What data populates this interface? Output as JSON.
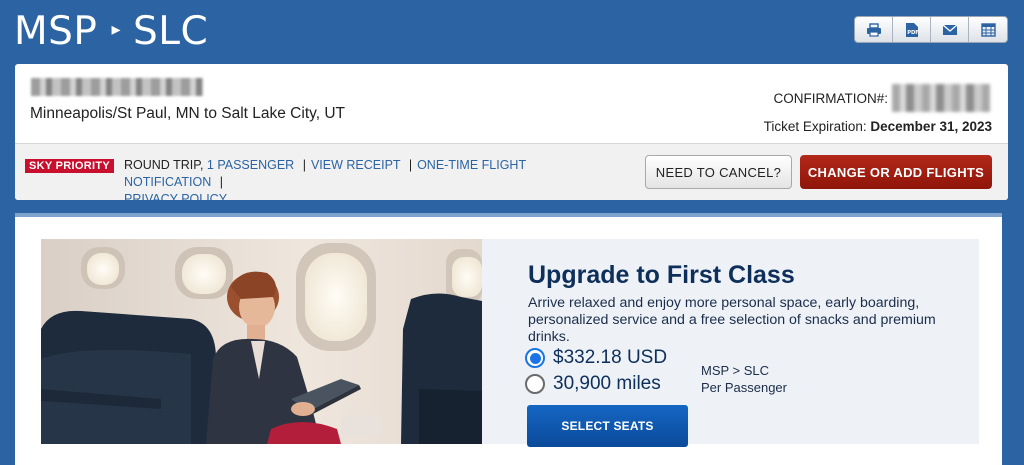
{
  "header": {
    "origin": "MSP",
    "destination": "SLC",
    "arrow": "▸",
    "tools": [
      {
        "name": "print-icon",
        "label": "🖶"
      },
      {
        "name": "pdf-icon",
        "label": "PDF"
      },
      {
        "name": "email-icon",
        "label": "✉"
      },
      {
        "name": "calendar-icon",
        "label": "▦"
      }
    ]
  },
  "trip": {
    "city_pair": "Minneapolis/St Paul, MN to Salt Lake City, UT",
    "confirmation_label": "CONFIRMATION#:",
    "expiry_label": "Ticket Expiration:",
    "expiry_date": "December 31, 2023",
    "badge": "SKY PRIORITY",
    "trip_type": "ROUND TRIP,",
    "passengers": "1 PASSENGER",
    "view_receipt": "VIEW RECEIPT",
    "notification": "ONE-TIME FLIGHT NOTIFICATION",
    "privacy": "PRIVACY POLICY",
    "cancel_label": "NEED TO CANCEL?",
    "change_label": "CHANGE OR ADD FLIGHTS"
  },
  "upgrade": {
    "title": "Upgrade to First Class",
    "description": "Arrive relaxed and enjoy more personal space, early boarding, personalized service and a free selection of snacks and premium drinks.",
    "options": [
      {
        "label": "$332.18 USD",
        "selected": true
      },
      {
        "label": "30,900 miles",
        "selected": false
      }
    ],
    "route_note": "MSP > SLC",
    "per_note": "Per Passenger",
    "button_label": "SELECT SEATS"
  },
  "colors": {
    "background": "#2b63a3",
    "accent_red": "#a11f12",
    "brand_navy": "#0e2f5a",
    "link_blue": "#2b63a3"
  }
}
